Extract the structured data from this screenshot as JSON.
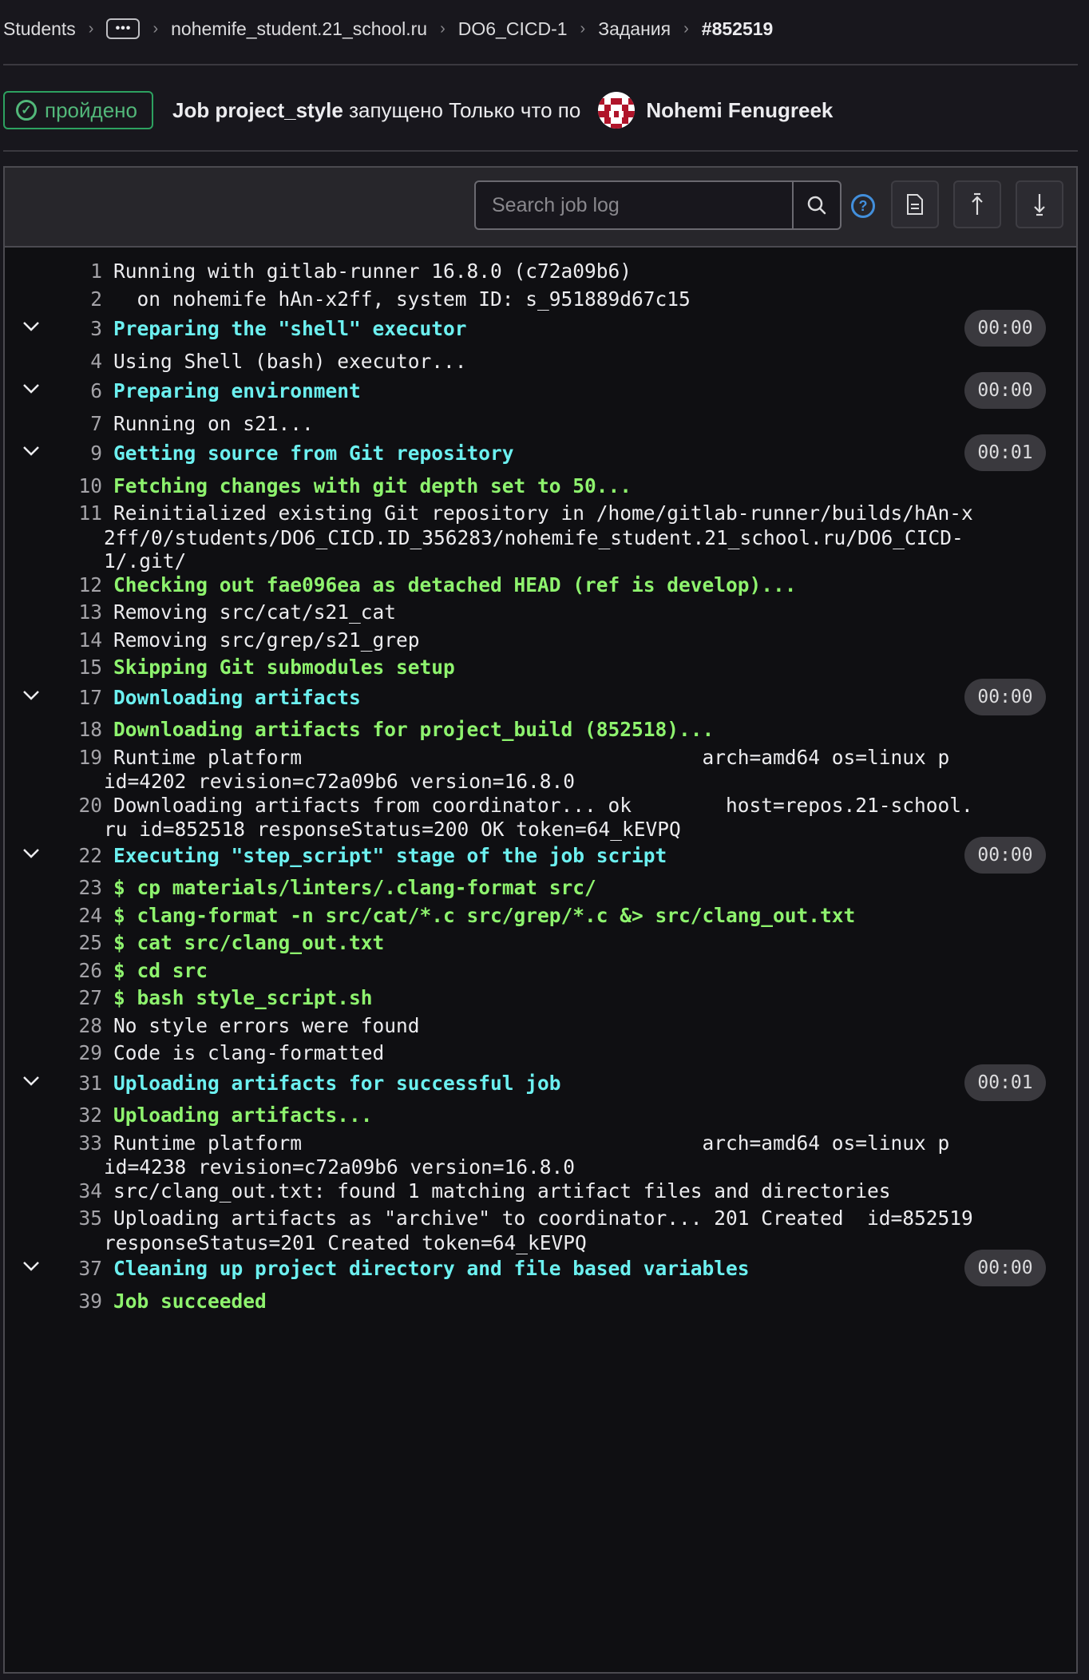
{
  "breadcrumb": [
    {
      "label": "Students"
    },
    {
      "label": "•••"
    },
    {
      "label": "nohemife_student.21_school.ru"
    },
    {
      "label": "DO6_CICD-1"
    },
    {
      "label": "Задания"
    },
    {
      "label": "#852519"
    }
  ],
  "header": {
    "status": "пройдено",
    "job_prefix": "Job project_style",
    "job_suffix": " запущено Только что по",
    "user": "Nohemi Fenugreek"
  },
  "toolbar": {
    "search_placeholder": "Search job log",
    "icons": [
      "search-icon",
      "help-icon",
      "raw-log-icon",
      "scroll-top-icon",
      "scroll-bottom-icon"
    ]
  },
  "colors": {
    "cyan": "#6cf0f0",
    "green": "#8ef36e",
    "status": "#52b87a",
    "link": "#428fdc"
  },
  "log_lines": [
    {
      "n": "1",
      "text": "Running with gitlab-runner 16.8.0 (c72a09b6)",
      "style": ""
    },
    {
      "n": "2",
      "text": "  on nohemife hAn-x2ff, system ID: s_951889d67c15",
      "style": ""
    },
    {
      "n": "3",
      "text": "Preparing the \"shell\" executor",
      "style": "cyan",
      "section": true,
      "duration": "00:00"
    },
    {
      "n": "4",
      "text": "Using Shell (bash) executor...",
      "style": ""
    },
    {
      "n": "6",
      "text": "Preparing environment",
      "style": "cyan",
      "section": true,
      "duration": "00:00"
    },
    {
      "n": "7",
      "text": "Running on s21...",
      "style": ""
    },
    {
      "n": "9",
      "text": "Getting source from Git repository",
      "style": "cyan",
      "section": true,
      "duration": "00:01"
    },
    {
      "n": "10",
      "text": "Fetching changes with git depth set to 50...",
      "style": "green"
    },
    {
      "n": "11",
      "text": "Reinitialized existing Git repository in /home/gitlab-runner/builds/hAn-x",
      "style": "",
      "cont": [
        "2ff/0/students/DO6_CICD.ID_356283/nohemife_student.21_school.ru/DO6_CICD-",
        "1/.git/"
      ]
    },
    {
      "n": "12",
      "text": "Checking out fae096ea as detached HEAD (ref is develop)...",
      "style": "green"
    },
    {
      "n": "13",
      "text": "Removing src/cat/s21_cat",
      "style": ""
    },
    {
      "n": "14",
      "text": "Removing src/grep/s21_grep",
      "style": ""
    },
    {
      "n": "15",
      "text": "Skipping Git submodules setup",
      "style": "green"
    },
    {
      "n": "17",
      "text": "Downloading artifacts",
      "style": "cyan",
      "section": true,
      "duration": "00:00"
    },
    {
      "n": "18",
      "text": "Downloading artifacts for project_build (852518)...",
      "style": "green"
    },
    {
      "n": "19",
      "text": "Runtime platform                                  arch=amd64 os=linux p",
      "style": "",
      "cont": [
        "id=4202 revision=c72a09b6 version=16.8.0"
      ]
    },
    {
      "n": "20",
      "text": "Downloading artifacts from coordinator... ok        host=repos.21-school.",
      "style": "",
      "cont": [
        "ru id=852518 responseStatus=200 OK token=64_kEVPQ"
      ]
    },
    {
      "n": "22",
      "text": "Executing \"step_script\" stage of the job script",
      "style": "cyan",
      "section": true,
      "duration": "00:00"
    },
    {
      "n": "23",
      "text": "$ cp materials/linters/.clang-format src/",
      "style": "green"
    },
    {
      "n": "24",
      "text": "$ clang-format -n src/cat/*.c src/grep/*.c &> src/clang_out.txt",
      "style": "green"
    },
    {
      "n": "25",
      "text": "$ cat src/clang_out.txt",
      "style": "green"
    },
    {
      "n": "26",
      "text": "$ cd src",
      "style": "green"
    },
    {
      "n": "27",
      "text": "$ bash style_script.sh",
      "style": "green"
    },
    {
      "n": "28",
      "text": "No style errors were found",
      "style": ""
    },
    {
      "n": "29",
      "text": "Code is clang-formatted",
      "style": ""
    },
    {
      "n": "31",
      "text": "Uploading artifacts for successful job",
      "style": "cyan",
      "section": true,
      "duration": "00:01"
    },
    {
      "n": "32",
      "text": "Uploading artifacts...",
      "style": "green"
    },
    {
      "n": "33",
      "text": "Runtime platform                                  arch=amd64 os=linux p",
      "style": "",
      "cont": [
        "id=4238 revision=c72a09b6 version=16.8.0"
      ]
    },
    {
      "n": "34",
      "text": "src/clang_out.txt: found 1 matching artifact files and directories",
      "style": ""
    },
    {
      "n": "35",
      "text": "Uploading artifacts as \"archive\" to coordinator... 201 Created  id=852519",
      "style": "",
      "cont": [
        "responseStatus=201 Created token=64_kEVPQ"
      ]
    },
    {
      "n": "37",
      "text": "Cleaning up project directory and file based variables",
      "style": "cyan",
      "section": true,
      "duration": "00:00"
    },
    {
      "n": "39",
      "text": "Job succeeded",
      "style": "green"
    }
  ]
}
